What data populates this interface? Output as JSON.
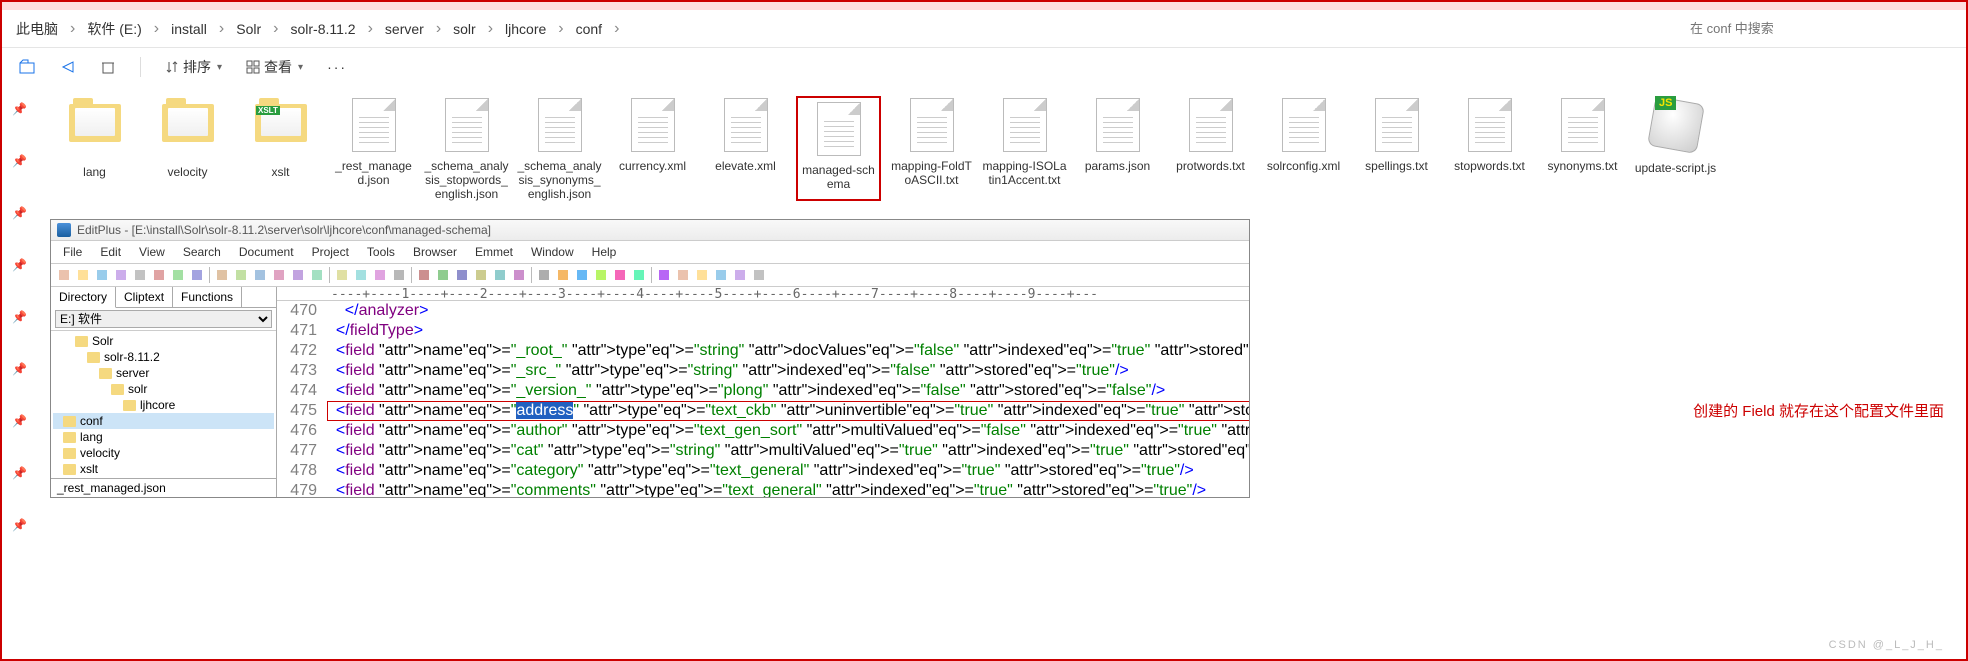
{
  "breadcrumb": [
    "此电脑",
    "软件 (E:)",
    "install",
    "Solr",
    "solr-8.11.2",
    "server",
    "solr",
    "ljhcore",
    "conf"
  ],
  "search": {
    "placeholder": "在 conf 中搜索"
  },
  "toolbar": {
    "sort": "排序",
    "view": "查看"
  },
  "files": [
    {
      "label": "lang",
      "type": "folder-paper"
    },
    {
      "label": "velocity",
      "type": "folder-paper"
    },
    {
      "label": "xslt",
      "type": "folder-xslt"
    },
    {
      "label": "_rest_managed.json",
      "type": "doc"
    },
    {
      "label": "_schema_analysis_stopwords_english.json",
      "type": "doc"
    },
    {
      "label": "_schema_analysis_synonyms_english.json",
      "type": "doc"
    },
    {
      "label": "currency.xml",
      "type": "doc"
    },
    {
      "label": "elevate.xml",
      "type": "doc"
    },
    {
      "label": "managed-schema",
      "type": "doc",
      "selected": true
    },
    {
      "label": "mapping-FoldToASCII.txt",
      "type": "doc"
    },
    {
      "label": "mapping-ISOLatin1Accent.txt",
      "type": "doc"
    },
    {
      "label": "params.json",
      "type": "doc"
    },
    {
      "label": "protwords.txt",
      "type": "doc"
    },
    {
      "label": "solrconfig.xml",
      "type": "doc"
    },
    {
      "label": "spellings.txt",
      "type": "doc"
    },
    {
      "label": "stopwords.txt",
      "type": "doc"
    },
    {
      "label": "synonyms.txt",
      "type": "doc"
    },
    {
      "label": "update-script.js",
      "type": "js"
    }
  ],
  "editor": {
    "title": "EditPlus - [E:\\install\\Solr\\solr-8.11.2\\server\\solr\\ljhcore\\conf\\managed-schema]",
    "menus": [
      "File",
      "Edit",
      "View",
      "Search",
      "Document",
      "Project",
      "Tools",
      "Browser",
      "Emmet",
      "Window",
      "Help"
    ],
    "side_tabs": [
      "Directory",
      "Cliptext",
      "Functions"
    ],
    "drive": "E:] 软件",
    "tree": [
      {
        "indent": 0,
        "name": "Solr"
      },
      {
        "indent": 1,
        "name": "solr-8.11.2"
      },
      {
        "indent": 2,
        "name": "server"
      },
      {
        "indent": 3,
        "name": "solr"
      },
      {
        "indent": 4,
        "name": "ljhcore"
      },
      {
        "indent": 5,
        "name": "conf",
        "sel": true
      },
      {
        "indent": 5,
        "name": "lang"
      },
      {
        "indent": 5,
        "name": "velocity"
      },
      {
        "indent": 5,
        "name": "xslt"
      }
    ],
    "filename_row": "_rest_managed.json",
    "lines": [
      {
        "n": 470,
        "raw": "    </analyzer>"
      },
      {
        "n": 471,
        "raw": "  </fieldType>"
      },
      {
        "n": 472,
        "raw": "  <field name=\"_root_\" type=\"string\" docValues=\"false\" indexed=\"true\" stored=\"false\"/>"
      },
      {
        "n": 473,
        "raw": "  <field name=\"_src_\" type=\"string\" indexed=\"false\" stored=\"true\"/>"
      },
      {
        "n": 474,
        "raw": "  <field name=\"_version_\" type=\"plong\" indexed=\"false\" stored=\"false\"/>"
      },
      {
        "n": 475,
        "raw": "  <field name=\"address\" type=\"text_ckb\" uninvertible=\"true\" indexed=\"true\" stored=\"true\"/>",
        "hl": true,
        "selword": "address"
      },
      {
        "n": 476,
        "raw": "  <field name=\"author\" type=\"text_gen_sort\" multiValued=\"false\" indexed=\"true\" stored=\"true\"/>"
      },
      {
        "n": 477,
        "raw": "  <field name=\"cat\" type=\"string\" multiValued=\"true\" indexed=\"true\" stored=\"true\"/>"
      },
      {
        "n": 478,
        "raw": "  <field name=\"category\" type=\"text_general\" indexed=\"true\" stored=\"true\"/>"
      },
      {
        "n": 479,
        "raw": "  <field name=\"comments\" type=\"text_general\" indexed=\"true\" stored=\"true\"/>"
      }
    ],
    "ruler": "----+----1----+----2----+----3----+----4----+----5----+----6----+----7----+----8----+----9----+---"
  },
  "annotation": "创建的 Field 就存在这个配置文件里面",
  "watermark": "CSDN @_L_J_H_"
}
